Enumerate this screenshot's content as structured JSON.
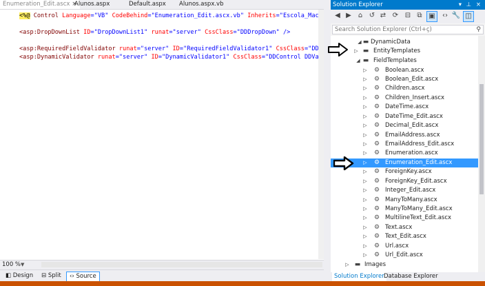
{
  "editor": {
    "tabs": [
      {
        "label": "Enumeration_Edit.ascx",
        "active": true
      },
      {
        "label": "Alunos.aspx",
        "active": false
      },
      {
        "label": "Default.aspx",
        "active": false
      },
      {
        "label": "Alunos.aspx.vb",
        "active": false
      }
    ],
    "close_glyph": "×",
    "code": {
      "l1": {
        "open": "<%@",
        "kw": " Control ",
        "a1": "Language",
        "v1": "=\"VB\"",
        "a2": " CodeBehind",
        "v2": "=\"Enumeration_Edit.ascx.vb\"",
        "a3": " Inherits",
        "v3": "=\"Escola_Mac"
      },
      "l2": {
        "tag": "<asp:DropDownList",
        "a1": " ID",
        "v1": "=\"DropDownList1\"",
        "a2": " runat",
        "v2": "=\"server\"",
        "a3": " CssClass",
        "v3": "=\"DDDropDown\"",
        "end": " />"
      },
      "l3": {
        "tag": "<asp:RequiredFieldValidator",
        "a1": " runat",
        "v1": "=\"server\"",
        "a2": " ID",
        "v2": "=\"RequiredFieldValidator1\"",
        "a3": " CssClass",
        "v3": "=\"DD"
      },
      "l4": {
        "tag": "<asp:DynamicValidator",
        "a1": " runat",
        "v1": "=\"server\"",
        "a2": " ID",
        "v2": "=\"DynamicValidator1\"",
        "a3": " CssClass",
        "v3": "=\"DDControl DDVa"
      }
    },
    "zoom": "100 %",
    "views": {
      "design": "Design",
      "split": "Split",
      "source": "Source"
    }
  },
  "solution_explorer": {
    "title": "Solution Explorer",
    "title_controls": "▾ ⊥ ×",
    "search_placeholder": "Search Solution Explorer (Ctrl+ç)",
    "tree": [
      {
        "label": "DynamicData",
        "level": 0,
        "expanded": true
      },
      {
        "label": "EntityTemplates",
        "level": 1,
        "expanded": false
      },
      {
        "label": "FieldTemplates",
        "level": 1,
        "expanded": true
      },
      {
        "label": "Boolean.ascx",
        "level": 2
      },
      {
        "label": "Boolean_Edit.ascx",
        "level": 2
      },
      {
        "label": "Children.ascx",
        "level": 2
      },
      {
        "label": "Children_Insert.ascx",
        "level": 2
      },
      {
        "label": "DateTime.ascx",
        "level": 2
      },
      {
        "label": "DateTime_Edit.ascx",
        "level": 2
      },
      {
        "label": "Decimal_Edit.ascx",
        "level": 2
      },
      {
        "label": "EmailAddress.ascx",
        "level": 2
      },
      {
        "label": "EmailAddress_Edit.ascx",
        "level": 2
      },
      {
        "label": "Enumeration.ascx",
        "level": 2
      },
      {
        "label": "Enumeration_Edit.ascx",
        "level": 2,
        "selected": true
      },
      {
        "label": "ForeignKey.ascx",
        "level": 2
      },
      {
        "label": "ForeignKey_Edit.ascx",
        "level": 2
      },
      {
        "label": "Integer_Edit.ascx",
        "level": 2
      },
      {
        "label": "ManyToMany.ascx",
        "level": 2
      },
      {
        "label": "ManyToMany_Edit.ascx",
        "level": 2
      },
      {
        "label": "MultilineText_Edit.ascx",
        "level": 2
      },
      {
        "label": "Text.ascx",
        "level": 2
      },
      {
        "label": "Text_Edit.ascx",
        "level": 2
      },
      {
        "label": "Url.ascx",
        "level": 2
      },
      {
        "label": "Url_Edit.ascx",
        "level": 2
      },
      {
        "label": "Images",
        "level": 1,
        "expanded": false
      }
    ],
    "tabs": {
      "solution": "Solution Explorer",
      "database": "Database Explorer"
    }
  },
  "colors": {
    "accent": "#007acc",
    "selection": "#3399ff",
    "status_bar": "#ca5100"
  }
}
